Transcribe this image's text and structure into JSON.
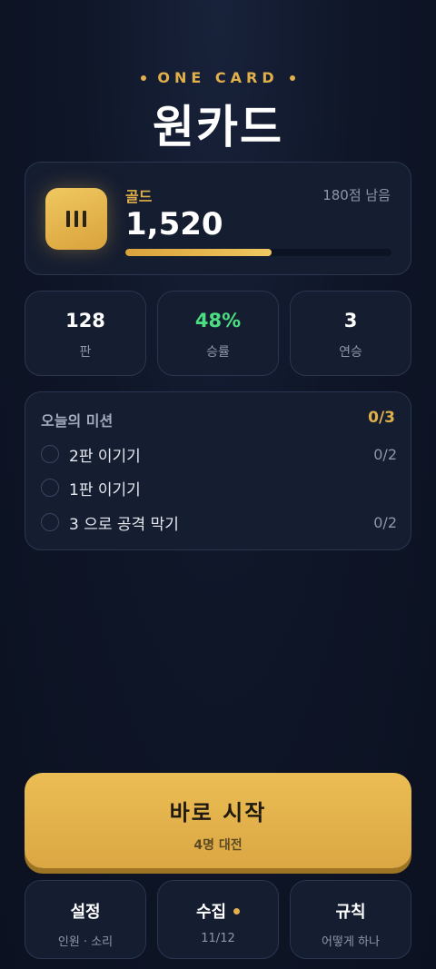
{
  "header": {
    "eyebrow": "ONE CARD",
    "title": "원카드"
  },
  "gold": {
    "label": "골드",
    "value": "1,520",
    "remaining": "180점 남음",
    "progress": 0.55
  },
  "stats": [
    {
      "value": "128",
      "label": "판"
    },
    {
      "value": "48%",
      "label": "승률"
    },
    {
      "value": "3",
      "label": "연승"
    }
  ],
  "missions": {
    "title": "오늘의 미션",
    "count": "0/3",
    "items": [
      {
        "text": "2판 이기기",
        "progress": "0/2"
      },
      {
        "text": "1판 이기기",
        "progress": ""
      },
      {
        "text": "3 으로 공격 막기",
        "progress": "0/2"
      }
    ]
  },
  "play": {
    "label": "바로 시작",
    "sub": "4명 대전"
  },
  "bottom": [
    {
      "title": "설정",
      "sub": "인원 · 소리"
    },
    {
      "title": "수집",
      "sub": "11/12"
    },
    {
      "title": "규칙",
      "sub": "어떻게 하나"
    }
  ],
  "colors": {
    "accent": "#e2b04a",
    "success": "#4ade80",
    "background": "#0f1628"
  }
}
